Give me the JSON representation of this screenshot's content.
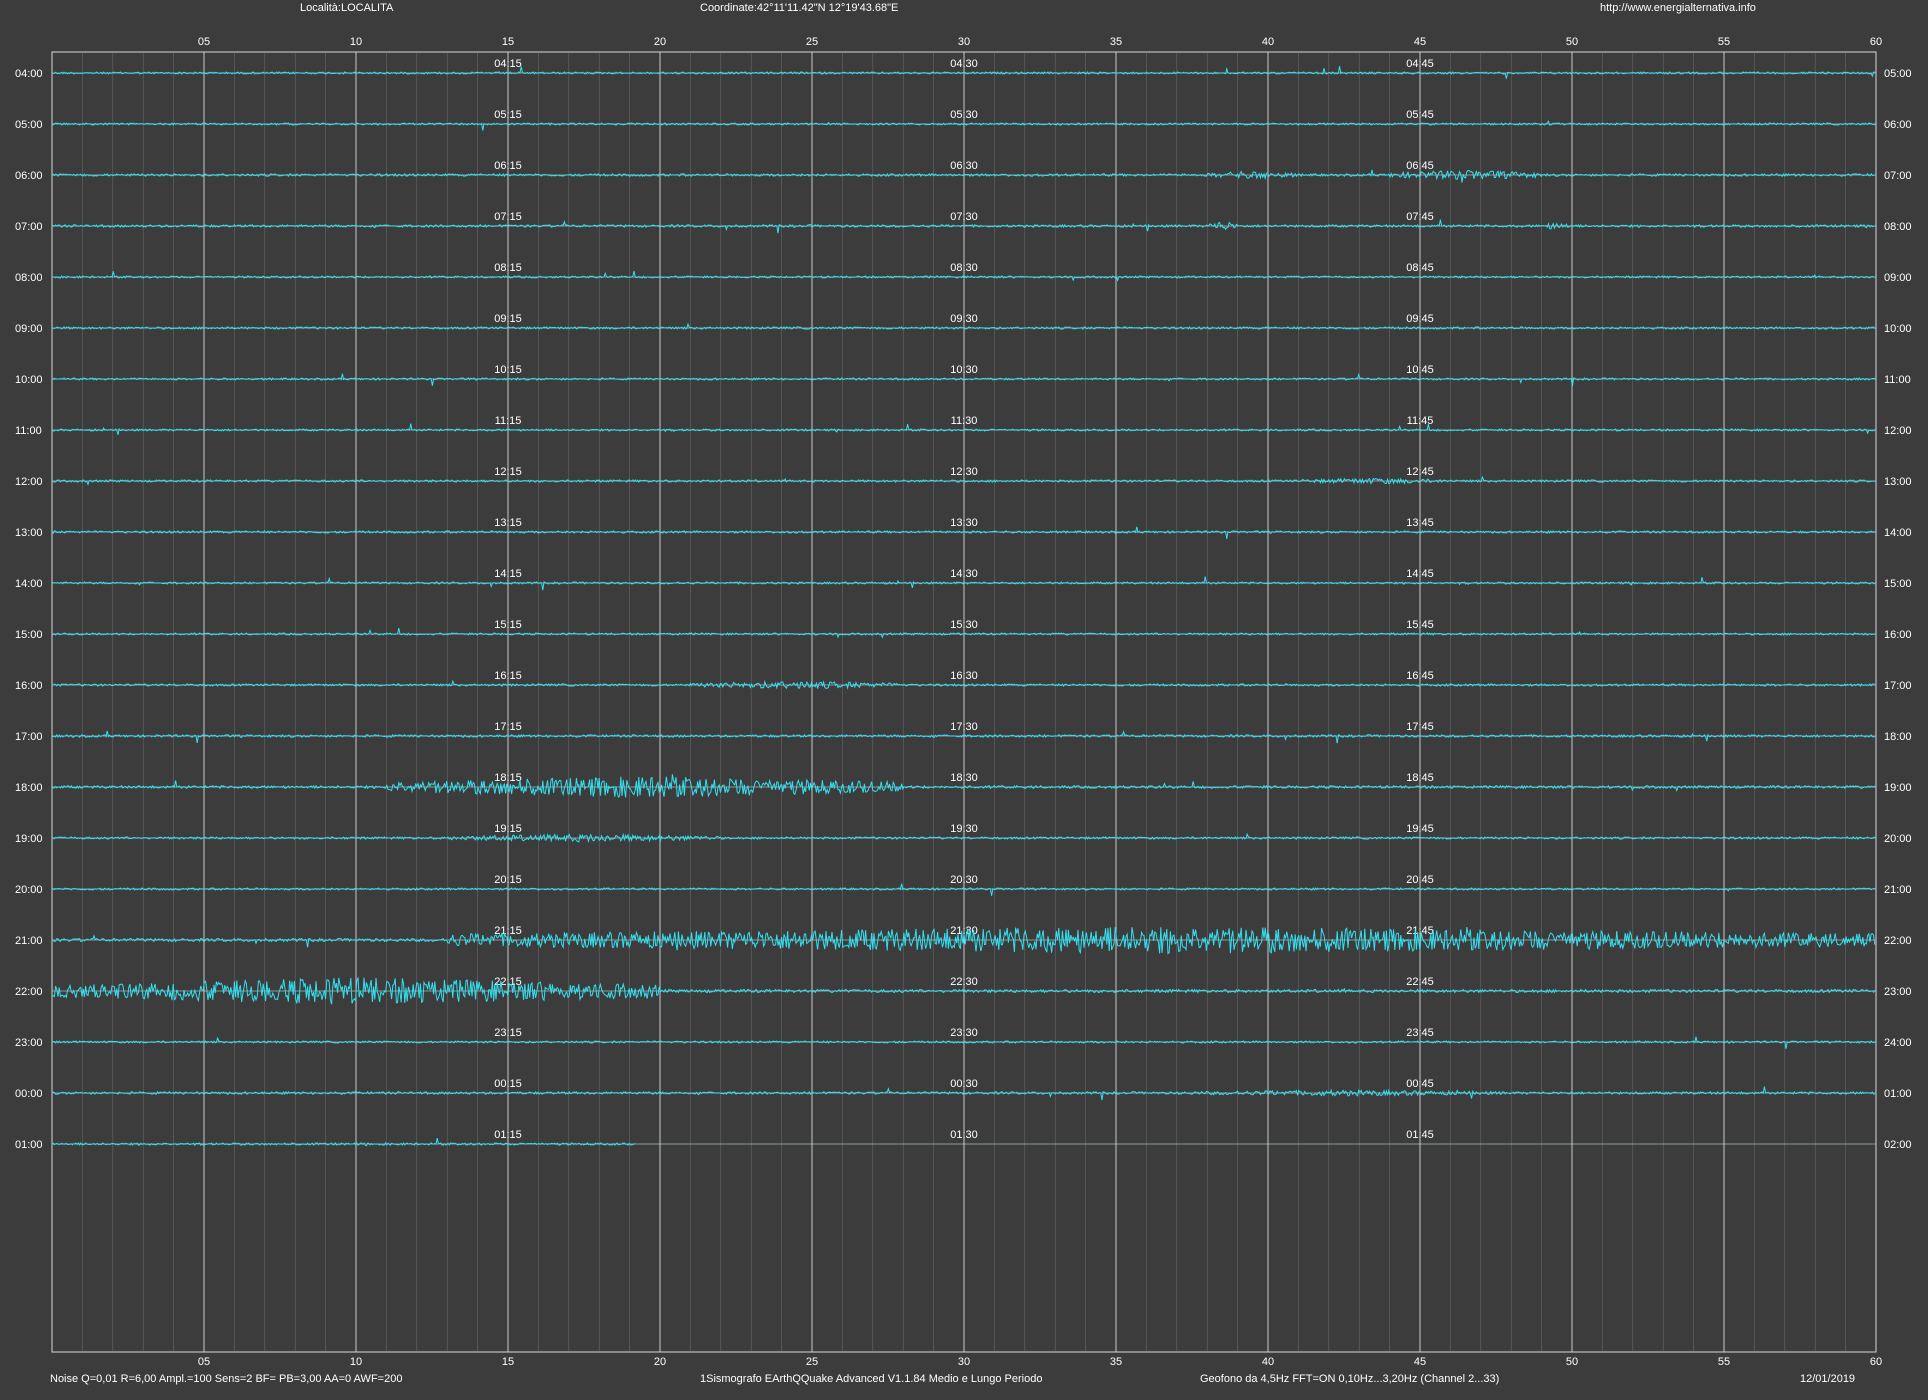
{
  "header": {
    "location": "Località:LOCALITA",
    "coordinates": "Coordinate:42°11'11.42\"N  12°19'43.68\"E",
    "url": "http://www.energialternativa.info"
  },
  "footer": {
    "params": "Noise Q=0,01 R=6,00 Ampl.=100 Sens=2 BF= PB=3,00 AA=0 AWF=200",
    "software": "1Sismografo  EArthQQuake Advanced V1.1.84  Medio e Lungo Periodo",
    "sensor": "Geofono da 4,5Hz FFT=ON 0,10Hz...3,20Hz      (Channel 2...33)",
    "date": "12/01/2019"
  },
  "chart_data": {
    "type": "line",
    "title": "",
    "xlabel": "",
    "ylabel": "",
    "xlim": [
      0,
      60
    ],
    "x_ticks": [
      "05",
      "10",
      "15",
      "20",
      "25",
      "30",
      "35",
      "40",
      "45",
      "50",
      "55",
      "60"
    ],
    "minor_grid": true,
    "trace_color": "#33e0f0",
    "grid_color": "#8c8c8c",
    "major_grid_color": "#d8d8d8",
    "background": "#3c3c3c",
    "rows": [
      {
        "left": "04:00",
        "right": "05:00",
        "q1": "04:15",
        "q2": "04:30",
        "q3": "04:45",
        "noise": 1.0,
        "events": []
      },
      {
        "left": "05:00",
        "right": "06:00",
        "q1": "05:15",
        "q2": "05:30",
        "q3": "05:45",
        "noise": 1.0,
        "events": []
      },
      {
        "left": "06:00",
        "right": "07:00",
        "q1": "06:15",
        "q2": "06:30",
        "q3": "06:45",
        "noise": 1.2,
        "events": [
          {
            "start": 38,
            "end": 41,
            "amp": 4
          },
          {
            "start": 44,
            "end": 49,
            "amp": 5
          }
        ]
      },
      {
        "left": "07:00",
        "right": "08:00",
        "q1": "07:15",
        "q2": "07:30",
        "q3": "07:45",
        "noise": 1.2,
        "events": [
          {
            "start": 38,
            "end": 39,
            "amp": 5
          },
          {
            "start": 49,
            "end": 50,
            "amp": 4
          }
        ]
      },
      {
        "left": "08:00",
        "right": "09:00",
        "q1": "08:15",
        "q2": "08:30",
        "q3": "08:45",
        "noise": 1.0,
        "events": []
      },
      {
        "left": "09:00",
        "right": "10:00",
        "q1": "09:15",
        "q2": "09:30",
        "q3": "09:45",
        "noise": 1.1,
        "events": []
      },
      {
        "left": "10:00",
        "right": "11:00",
        "q1": "10:15",
        "q2": "10:30",
        "q3": "10:45",
        "noise": 1.0,
        "events": []
      },
      {
        "left": "11:00",
        "right": "12:00",
        "q1": "11:15",
        "q2": "11:30",
        "q3": "11:45",
        "noise": 1.0,
        "events": []
      },
      {
        "left": "12:00",
        "right": "13:00",
        "q1": "12:15",
        "q2": "12:30",
        "q3": "12:45",
        "noise": 1.1,
        "events": [
          {
            "start": 41,
            "end": 46,
            "amp": 3
          }
        ]
      },
      {
        "left": "13:00",
        "right": "14:00",
        "q1": "13:15",
        "q2": "13:30",
        "q3": "13:45",
        "noise": 1.1,
        "events": []
      },
      {
        "left": "14:00",
        "right": "15:00",
        "q1": "14:15",
        "q2": "14:30",
        "q3": "14:45",
        "noise": 1.0,
        "events": []
      },
      {
        "left": "15:00",
        "right": "16:00",
        "q1": "15:15",
        "q2": "15:30",
        "q3": "15:45",
        "noise": 1.0,
        "events": []
      },
      {
        "left": "16:00",
        "right": "17:00",
        "q1": "16:15",
        "q2": "16:30",
        "q3": "16:45",
        "noise": 1.1,
        "events": [
          {
            "start": 21,
            "end": 28,
            "amp": 4
          }
        ]
      },
      {
        "left": "17:00",
        "right": "18:00",
        "q1": "17:15",
        "q2": "17:30",
        "q3": "17:45",
        "noise": 1.2,
        "events": []
      },
      {
        "left": "18:00",
        "right": "19:00",
        "q1": "18:15",
        "q2": "18:30",
        "q3": "18:45",
        "noise": 1.3,
        "events": [
          {
            "start": 11,
            "end": 28,
            "amp": 11
          }
        ]
      },
      {
        "left": "19:00",
        "right": "20:00",
        "q1": "19:15",
        "q2": "19:30",
        "q3": "19:45",
        "noise": 1.1,
        "events": [
          {
            "start": 13,
            "end": 22,
            "amp": 4
          }
        ]
      },
      {
        "left": "20:00",
        "right": "21:00",
        "q1": "20:15",
        "q2": "20:30",
        "q3": "20:45",
        "noise": 1.0,
        "events": []
      },
      {
        "left": "21:00",
        "right": "22:00",
        "q1": "21:15",
        "q2": "21:30",
        "q3": "21:45",
        "noise": 1.5,
        "events": [
          {
            "start": 13,
            "end": 60,
            "amp": 14
          }
        ]
      },
      {
        "left": "22:00",
        "right": "23:00",
        "q1": "22:15",
        "q2": "22:30",
        "q3": "22:45",
        "noise": 1.5,
        "events": [
          {
            "start": 0,
            "end": 20,
            "amp": 14
          }
        ]
      },
      {
        "left": "23:00",
        "right": "24:00",
        "q1": "23:15",
        "q2": "23:30",
        "q3": "23:45",
        "noise": 1.0,
        "events": []
      },
      {
        "left": "00:00",
        "right": "01:00",
        "q1": "00:15",
        "q2": "00:30",
        "q3": "00:45",
        "noise": 1.2,
        "events": [
          {
            "start": 37,
            "end": 48,
            "amp": 3
          }
        ]
      },
      {
        "left": "01:00",
        "right": "02:00",
        "q1": "01:15",
        "q2": "01:30",
        "q3": "01:45",
        "noise": 1.1,
        "events": [],
        "trace_end": 19.2
      }
    ]
  }
}
